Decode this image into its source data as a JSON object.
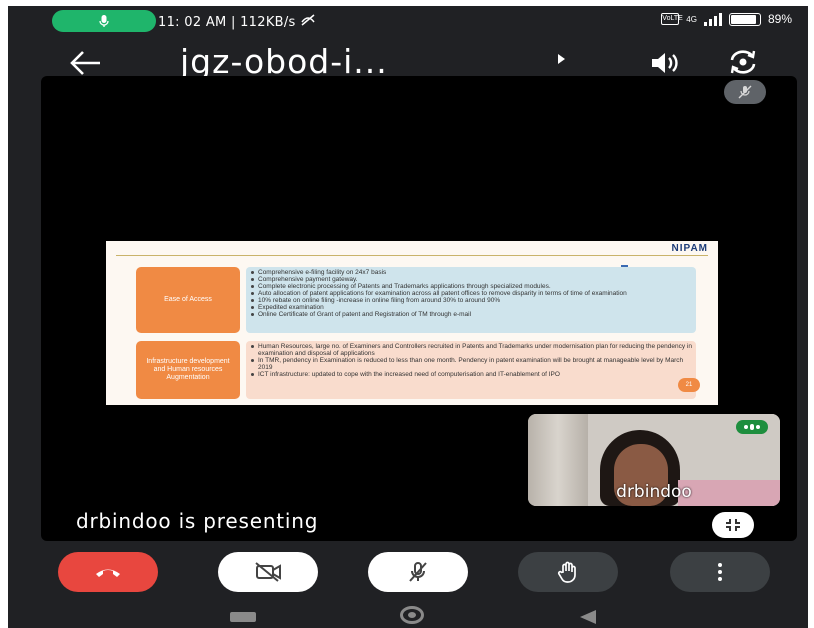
{
  "status_bar": {
    "time": "11: 02 AM",
    "separator": "|",
    "network_speed": "112KB/s",
    "sim_label": "VoLTE",
    "network_type": "4G",
    "battery_text": "89",
    "battery_level": 0.89,
    "mic_pill_color": "#1fb56b"
  },
  "app_bar": {
    "title": "jgz-obod-i...",
    "back_icon": "arrow-back",
    "volume_icon": "speaker",
    "camera_flip_icon": "camera-switch"
  },
  "slide": {
    "brand": "NIPAM",
    "rows": [
      {
        "label": "Ease of Access",
        "bullets": [
          "Comprehensive e-filing facility on 24x7 basis",
          "Comprehensive payment gateway.",
          "Complete electronic processing of Patents and Trademarks applications through specialized modules.",
          "Auto allocation of patent applications for examination across all patent offices to remove disparity in terms of time of examination",
          "10% rebate on online filing -increase in online filing from around 30% to around 90%",
          "Expedited examination",
          "Online Certificate of Grant of patent and Registration of TM through e-mail"
        ]
      },
      {
        "label": "Infrastructure development and Human resources Augmentation",
        "bullets": [
          "Human Resources, large no. of Examiners and Controllers recruited in Patents and Trademarks under modernisation plan for reducing the pendency in examination and disposal of applications",
          "In TMR, pendency in Examination is reduced to less than one month. Pendency in patent examination will be brought at manageable level by March 2019",
          "ICT infrastructure: updated to cope with the increased need of computerisation and IT-enablement of IPO"
        ]
      }
    ],
    "page_marker": "21",
    "colors": {
      "label_orange": "#f08a44",
      "row1_bg": "#cfe4ec",
      "row2_bg": "#f9dccd"
    }
  },
  "participant": {
    "name": "drbindoo"
  },
  "presenting_text": "drbindoo is presenting",
  "controls": {
    "end_call": {
      "icon": "phone-hangup-icon",
      "color": "#e8473f"
    },
    "camera": {
      "icon": "camera-off-icon"
    },
    "microphone": {
      "icon": "mic-off-icon"
    },
    "raise_hand": {
      "icon": "hand-icon"
    },
    "more": {
      "icon": "more-vert-icon"
    }
  },
  "nav_bar": {
    "recents": "recents",
    "home": "home",
    "back": "back"
  }
}
